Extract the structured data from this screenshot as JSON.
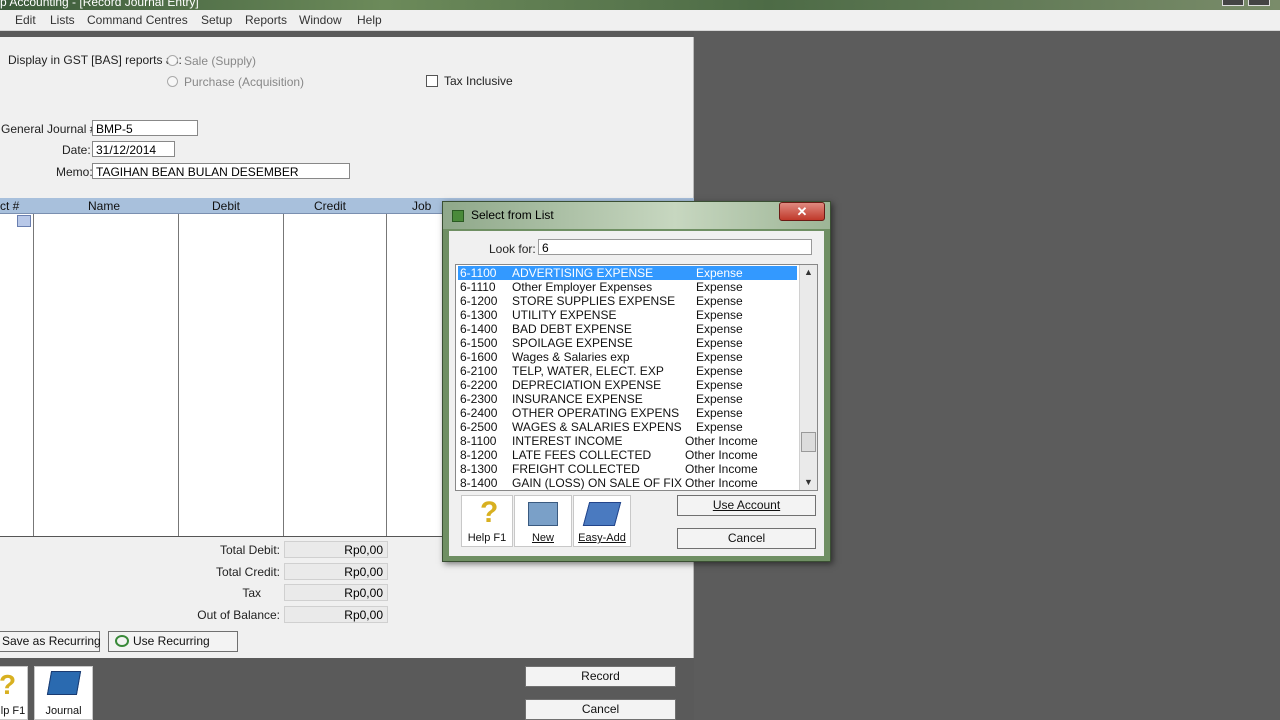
{
  "window": {
    "title": "p Accounting - [Record Journal Entry]"
  },
  "menu": [
    "Edit",
    "Lists",
    "Command Centres",
    "Setup",
    "Reports",
    "Window",
    "Help"
  ],
  "journal": {
    "gst_label": "Display in GST [BAS] reports as:",
    "gst_options": [
      "Sale (Supply)",
      "Purchase (Acquisition)"
    ],
    "tax_inclusive_label": "Tax Inclusive",
    "journal_no_label": "General Journal #:",
    "journal_no": "BMP-5",
    "date_label": "Date:",
    "date": "31/12/2014",
    "memo_label": "Memo:",
    "memo": "TAGIHAN BEAN BULAN DESEMBER",
    "columns": [
      "ct #",
      "Name",
      "Debit",
      "Credit",
      "Job"
    ],
    "totals": [
      {
        "label": "Total Debit:",
        "value": "Rp0,00"
      },
      {
        "label": "Total Credit:",
        "value": "Rp0,00"
      },
      {
        "label": "Tax",
        "value": "Rp0,00"
      },
      {
        "label": "Out of Balance:",
        "value": "Rp0,00"
      }
    ],
    "save_recurring": "Save as Recurring",
    "use_recurring": "Use Recurring",
    "help_label": "lp F1",
    "journal_label": "Journal",
    "record": "Record",
    "cancel": "Cancel"
  },
  "dialog": {
    "title": "Select from List",
    "close": "✕",
    "look_for_label": "Look for:",
    "look_for_value": "6",
    "rows": [
      {
        "code": "6-1100",
        "name": "ADVERTISING EXPENSE",
        "type": "Expense"
      },
      {
        "code": "6-1110",
        "name": "Other Employer Expenses",
        "type": "Expense"
      },
      {
        "code": "6-1200",
        "name": "STORE SUPPLIES EXPENSE",
        "type": "Expense"
      },
      {
        "code": "6-1300",
        "name": "UTILITY EXPENSE",
        "type": "Expense"
      },
      {
        "code": "6-1400",
        "name": "BAD DEBT EXPENSE",
        "type": "Expense"
      },
      {
        "code": "6-1500",
        "name": "SPOILAGE EXPENSE",
        "type": "Expense"
      },
      {
        "code": "6-1600",
        "name": "Wages & Salaries exp",
        "type": "Expense"
      },
      {
        "code": "6-2100",
        "name": "TELP, WATER, ELECT. EXP",
        "type": "Expense"
      },
      {
        "code": "6-2200",
        "name": "DEPRECIATION EXPENSE",
        "type": "Expense"
      },
      {
        "code": "6-2300",
        "name": "INSURANCE EXPENSE",
        "type": "Expense"
      },
      {
        "code": "6-2400",
        "name": "OTHER OPERATING EXPENS",
        "type": "Expense"
      },
      {
        "code": "6-2500",
        "name": "WAGES & SALARIES EXPENS",
        "type": "Expense"
      },
      {
        "code": "8-1100",
        "name": "INTEREST INCOME",
        "type": "Other Income"
      },
      {
        "code": "8-1200",
        "name": "LATE FEES COLLECTED",
        "type": "Other Income"
      },
      {
        "code": "8-1300",
        "name": "FREIGHT COLLECTED",
        "type": "Other Income"
      },
      {
        "code": "8-1400",
        "name": "GAIN (LOSS) ON SALE OF FIX",
        "type": "Other Income"
      }
    ],
    "help": "Help F1",
    "new": "New",
    "easy_add": "Easy-Add",
    "use_account": "Use Account",
    "cancel": "Cancel"
  }
}
